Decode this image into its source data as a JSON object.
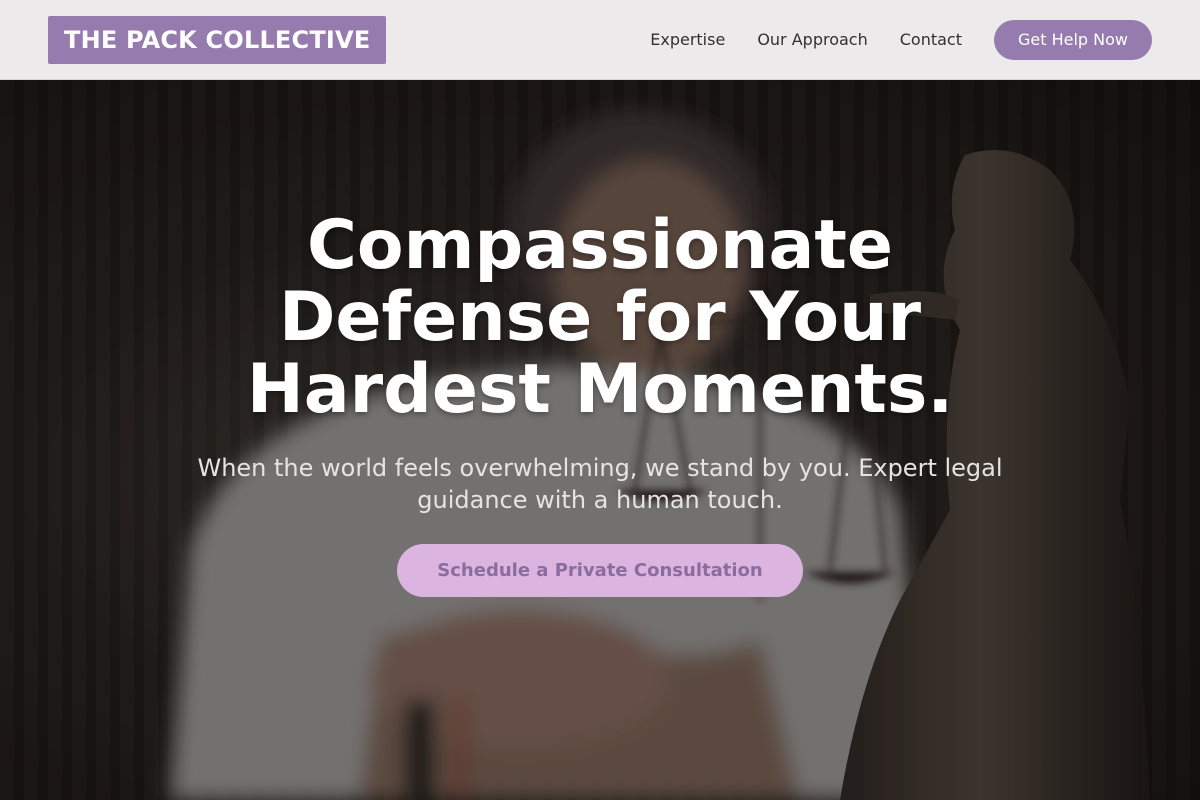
{
  "header": {
    "logo_text": "THE PACK COLLECTIVE",
    "nav": [
      {
        "label": "Expertise"
      },
      {
        "label": "Our Approach"
      },
      {
        "label": "Contact"
      }
    ],
    "cta_label": "Get Help Now"
  },
  "hero": {
    "headline": "Compassionate Defense for Your Hardest Moments.",
    "subheadline": "When the world feels overwhelming, we stand by you. Expert legal guidance with a human touch.",
    "cta_label": "Schedule a Private Consultation"
  },
  "colors": {
    "brand": "#957bae",
    "cta_light": "#dcb4e0",
    "header_bg": "#edeaeb"
  }
}
